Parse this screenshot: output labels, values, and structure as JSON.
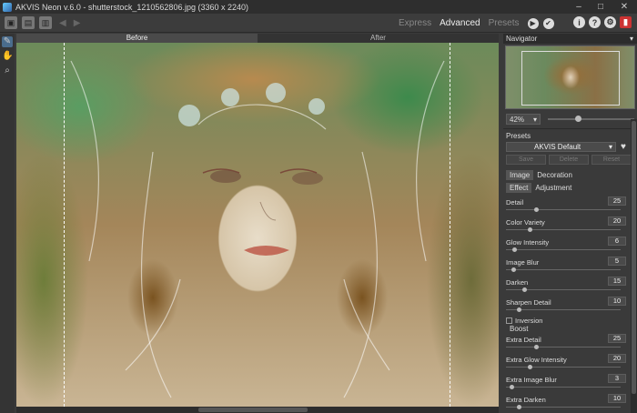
{
  "window": {
    "title": "AKVIS Neon v.6.0 - shutterstock_1210562806.jpg (3360 x 2240)",
    "minimize": "–",
    "maximize": "□",
    "close": "✕"
  },
  "toolbar": {
    "modes": [
      "Express",
      "Advanced",
      "Presets"
    ],
    "active_mode": "Advanced",
    "run_glyph": "▶",
    "apply_glyph": "✔",
    "info_glyph": "i",
    "help_glyph": "?",
    "settings_glyph": "⚙",
    "undo_glyph": "◀",
    "redo_glyph": "▶"
  },
  "left_tools": [
    "paint-tool",
    "hand-tool",
    "zoom-tool"
  ],
  "view_tabs": {
    "before": "Before",
    "after": "After"
  },
  "navigator": {
    "title": "Navigator",
    "zoom": "42%"
  },
  "presets": {
    "label": "Presets",
    "selected": "AKVIS Default",
    "buttons": [
      "Save",
      "Delete",
      "Reset"
    ]
  },
  "tabs_top": [
    "Image",
    "Decoration"
  ],
  "tabs_sub": [
    "Effect",
    "Adjustment"
  ],
  "params_main": [
    {
      "name": "Detail",
      "value": "25",
      "pos": 0.25
    },
    {
      "name": "Color Variety",
      "value": "20",
      "pos": 0.2
    },
    {
      "name": "Glow Intensity",
      "value": "6",
      "pos": 0.06
    },
    {
      "name": "Image Blur",
      "value": "5",
      "pos": 0.05
    },
    {
      "name": "Darken",
      "value": "15",
      "pos": 0.15
    },
    {
      "name": "Sharpen Detail",
      "value": "10",
      "pos": 0.1
    }
  ],
  "inversion": "Inversion",
  "boost": "Boost",
  "params_boost": [
    {
      "name": "Extra Detail",
      "value": "25",
      "pos": 0.25
    },
    {
      "name": "Extra Glow Intensity",
      "value": "20",
      "pos": 0.2
    },
    {
      "name": "Extra Image Blur",
      "value": "3",
      "pos": 0.03
    },
    {
      "name": "Extra Darken",
      "value": "10",
      "pos": 0.1
    }
  ],
  "colors": {
    "accent": "#4a6c8c",
    "panel": "#3a3a3a",
    "close_book": "#cc3333"
  }
}
